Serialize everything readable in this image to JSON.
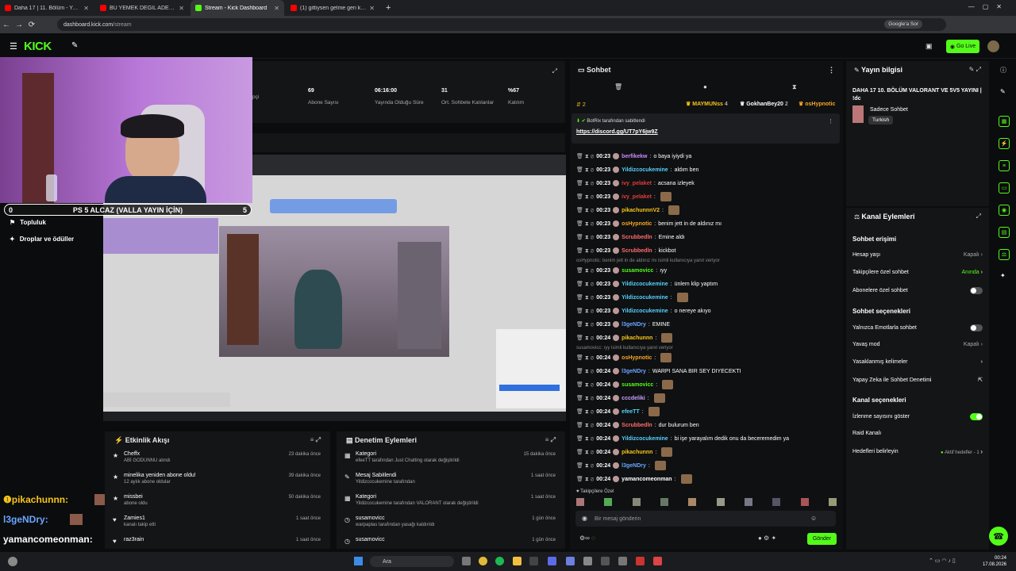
{
  "browser": {
    "tabs": [
      {
        "label": "Daha 17 | 11. Bölüm - YouTube",
        "color": "#ff0000"
      },
      {
        "label": "BU YEMEK DEĞİL ADETA ŞÖLE",
        "color": "#ff0000"
      },
      {
        "label": "Stream - Kick Dashboard",
        "color": "#53fc18"
      },
      {
        "label": "(1) gittiysen gelme geri kedi 1",
        "color": "#ff0000"
      }
    ],
    "url_host": "dashboard.kick.com",
    "url_path": "/stream",
    "google_lens": "Google'a Sor"
  },
  "topnav": {
    "logo": "KICK",
    "go_live": "Go Live"
  },
  "stats": [
    {
      "value": "",
      "label": "pçi"
    },
    {
      "value": "69",
      "label": "Abone Sayısı"
    },
    {
      "value": "06:16:00",
      "label": "Yayında Olduğu Süre"
    },
    {
      "value": "31",
      "label": "Ort. Sohbete Katılanlar"
    },
    {
      "value": "%67",
      "label": "Katılım"
    }
  ],
  "goal": {
    "left": "0",
    "title": "PS 5 ALCAZ (VALLA YAYIN İÇİN)",
    "right": "5"
  },
  "sidemenu": [
    "Denetleme",
    "Topluluk",
    "Droplar ve ödüller"
  ],
  "overlay_chat": [
    {
      "name": "pikachunnn:",
      "color": "#f5c518"
    },
    {
      "name": "l3geNDry:",
      "color": "#6aa6ff"
    },
    {
      "name": "yamancomeonman:",
      "color": "#ffffff"
    }
  ],
  "activity": {
    "title": "Etkinlik Akışı",
    "items": [
      {
        "name": "Cheffx",
        "detail": "ABİ GODUNNU alındı",
        "time": "23 dakika önce",
        "icon": "★"
      },
      {
        "name": "minelika yeniden abone oldu!",
        "detail": "12 aylık abone oldular",
        "time": "39 dakika önce",
        "icon": "★"
      },
      {
        "name": "missbei",
        "detail": "abone oldu",
        "time": "50 dakika önce",
        "icon": "★"
      },
      {
        "name": "Zamies1",
        "detail": "kanalı takip etti",
        "time": "1 saat önce",
        "icon": "♥"
      },
      {
        "name": "raz3rain",
        "detail": "",
        "time": "1 saat önce",
        "icon": "♥"
      }
    ]
  },
  "moderation": {
    "title": "Denetim Eylemleri",
    "items": [
      {
        "name": "Kategori",
        "detail": "efeeTT tarafından Just Chatting olarak değiştirildi",
        "time": "15 dakika önce",
        "icon": "▦"
      },
      {
        "name": "Mesaj Sabitlendi",
        "detail": "Yildizcocukemine tarafından",
        "time": "1 saat önce",
        "icon": "✎"
      },
      {
        "name": "Kategori",
        "detail": "Yildizcocukemine tarafından VALORANT olarak değiştirildi",
        "time": "1 saat önce",
        "icon": "▦"
      },
      {
        "name": "susamovicc",
        "detail": "warpaplas tarafından yasağı kaldırıldı",
        "time": "1 gün önce",
        "icon": "◷"
      },
      {
        "name": "susamovicc",
        "detail": "",
        "time": "1 gün önce",
        "icon": "◷"
      }
    ]
  },
  "chat": {
    "title": "Sohbet",
    "top_users": [
      {
        "name": "MAYMUNss",
        "count": "4"
      },
      {
        "name": "GokhanBey20",
        "count": "2"
      },
      {
        "name": "osHypnotic",
        "count": ""
      }
    ],
    "top_left": "2",
    "pinned": {
      "by": "BotRix tarafından sabitlendi",
      "link": "https://discord.gg/UT7pY6jw9Z"
    },
    "messages": [
      {
        "time": "00:23",
        "user": "berfikekw",
        "color": "#c98cff",
        "text": "o baya iyiydi ya"
      },
      {
        "time": "00:23",
        "user": "Yildizcocukemine",
        "color": "#55d0ff",
        "text": "aldım ben"
      },
      {
        "time": "00:23",
        "user": "ivy_pelaket",
        "color": "#e03c3c",
        "text": "acsana izleyek"
      },
      {
        "time": "00:23",
        "user": "ivy_pelaket",
        "color": "#e03c3c",
        "text": ""
      },
      {
        "time": "00:23",
        "user": "pikachunnnV2",
        "color": "#f5c518",
        "text": ""
      },
      {
        "time": "00:23",
        "user": "osHypnotic",
        "color": "#f5a623",
        "text": "benim jett in de aldınız mı"
      },
      {
        "time": "00:23",
        "user": "Scrubbedln",
        "color": "#ff6b6b",
        "text": "Emine aldı"
      },
      {
        "time": "00:23",
        "user": "Scrubbedln",
        "color": "#ff6b6b",
        "text": "kickbot"
      },
      {
        "time": "00:23",
        "user": "susamovicc",
        "color": "#53fc18",
        "text": "ıyy"
      },
      {
        "time": "00:23",
        "user": "Yildizcocukemine",
        "color": "#55d0ff",
        "text": "ünlem klip yaptım"
      },
      {
        "time": "00:23",
        "user": "Yildizcocukemine",
        "color": "#55d0ff",
        "text": ""
      },
      {
        "time": "00:23",
        "user": "Yildizcocukemine",
        "color": "#55d0ff",
        "text": "o nereye akıyo"
      },
      {
        "time": "00:23",
        "user": "l3geNDry",
        "color": "#6aa6ff",
        "text": "EMINE"
      },
      {
        "time": "00:24",
        "user": "pikachunnn",
        "color": "#f5c518",
        "text": ""
      },
      {
        "time": "00:24",
        "user": "osHypnotic",
        "color": "#f5a623",
        "text": ""
      },
      {
        "time": "00:24",
        "user": "l3geNDry",
        "color": "#6aa6ff",
        "text": "WARPI SANA BIR SEY DIYECEKTI"
      },
      {
        "time": "00:24",
        "user": "susamovicc",
        "color": "#53fc18",
        "text": ""
      },
      {
        "time": "00:24",
        "user": "cccdeliki",
        "color": "#c9a0ff",
        "text": ""
      },
      {
        "time": "00:24",
        "user": "efeeTT",
        "color": "#55d0ff",
        "text": ""
      },
      {
        "time": "00:24",
        "user": "Scrubbedln",
        "color": "#ff6b6b",
        "text": "dur bulurum ben"
      },
      {
        "time": "00:24",
        "user": "Yildizcocukemine",
        "color": "#55d0ff",
        "text": "bi işe yarayalım dedik onu da beceremedim ya"
      },
      {
        "time": "00:24",
        "user": "pikachunnn",
        "color": "#f5c518",
        "text": ""
      },
      {
        "time": "00:24",
        "user": "l3geNDry",
        "color": "#6aa6ff",
        "text": ""
      },
      {
        "time": "00:24",
        "user": "yamancomeonman",
        "color": "#ffffff",
        "text": ""
      }
    ],
    "reply_notes": [
      "osHypnotic: benim jett in de aldınız mı isimli kullanıcıya yanıt veriyor",
      "susamovicc: ıyy isimli kullanıcıya yanıt veriyor"
    ],
    "followers_only": "Takipçilere Özel",
    "input_placeholder": "Bir mesaj gönderin",
    "send": "Gönder"
  },
  "stream_info": {
    "title": "Yayın bilgisi",
    "stream_title": "DAHA 17 10. BÖLÜM VALORANT VE 5V5 YAYINI | !dc",
    "category": "Sadece Sohbet",
    "tag": "Turkish"
  },
  "channel_actions": {
    "title": "Kanal Eylemleri",
    "sections": [
      {
        "heading": "Sohbet erişimi",
        "rows": [
          {
            "label": "Hesap yaşı",
            "value": "Kapalı",
            "control": "chevron"
          },
          {
            "label": "Takipçilere özel sohbet",
            "value": "Anında",
            "control": "chevron"
          },
          {
            "label": "Abonelere özel sohbet",
            "value": "",
            "control": "toggle-off"
          }
        ]
      },
      {
        "heading": "Sohbet seçenekleri",
        "rows": [
          {
            "label": "Yalnızca Emotlarla sohbet",
            "value": "",
            "control": "toggle-off"
          },
          {
            "label": "Yavaş mod",
            "value": "Kapalı",
            "control": "chevron"
          },
          {
            "label": "Yasaklanmış kelimeler",
            "value": "",
            "control": "chevron"
          },
          {
            "label": "Yapay Zeka ile Sohbet Denetimi",
            "value": "",
            "control": "external"
          }
        ]
      },
      {
        "heading": "Kanal seçenekleri",
        "rows": [
          {
            "label": "İzlenme sayısını göster",
            "value": "",
            "control": "toggle-on"
          },
          {
            "label": "Raid Kanalı",
            "value": "",
            "control": "none"
          },
          {
            "label": "Hedefleri belirleyin",
            "value": "Aktif hedefler - 1",
            "control": "chevron"
          }
        ]
      }
    ]
  },
  "taskbar": {
    "search": "Ara",
    "time": "00:24",
    "date": "17.08.2026"
  },
  "colors": {
    "accent": "#53fc18",
    "bg": "#0b0c0e",
    "panel": "#141517"
  }
}
